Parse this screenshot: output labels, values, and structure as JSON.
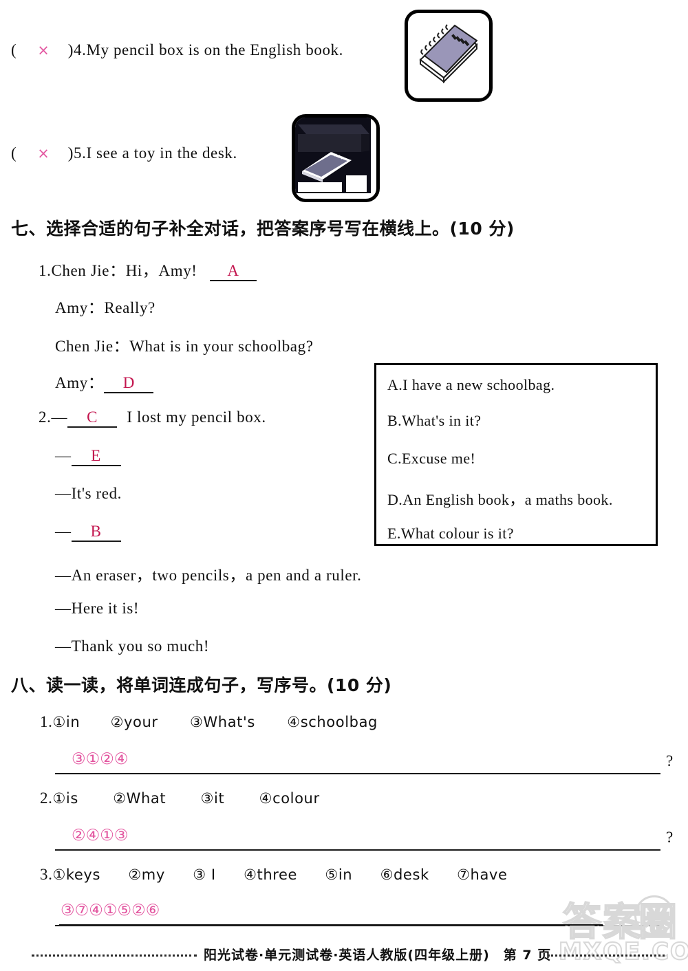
{
  "truefalse": {
    "items": [
      {
        "open": "(",
        "mark": "×",
        "close": ")",
        "number": "4.",
        "sentence": "My pencil box is on the English book.",
        "picture": "notebook-icon"
      },
      {
        "open": "(",
        "mark": "×",
        "close": ")",
        "number": "5.",
        "sentence": "I see a toy in the desk.",
        "picture": "desk-with-notebook-icon"
      }
    ]
  },
  "section7": {
    "heading": "七、选择合适的句子补全对话，把答案序号写在横线上。(10 分)",
    "dialog1": {
      "number": "1.",
      "lines": [
        {
          "speaker": "Chen Jie：",
          "text": "Hi，Amy!",
          "answer": "A"
        },
        {
          "speaker": "Amy：",
          "text": "Really?",
          "answer": ""
        },
        {
          "speaker": "Chen Jie：",
          "text": "What is in your schoolbag?",
          "answer": ""
        },
        {
          "speaker": "Amy：",
          "text": "",
          "answer": "D"
        }
      ]
    },
    "dialog2": {
      "number": "2.",
      "lines": [
        {
          "dash": "—",
          "answer": "C",
          "text": "I lost my pencil box."
        },
        {
          "dash": "—",
          "answer": "E",
          "text": ""
        },
        {
          "dash": "—",
          "answer": "",
          "text": "It's red."
        },
        {
          "dash": "—",
          "answer": "B",
          "text": ""
        },
        {
          "dash": "—",
          "answer": "",
          "text": "An eraser，two pencils，a pen and a ruler."
        },
        {
          "dash": "—",
          "answer": "",
          "text": "Here it is!"
        },
        {
          "dash": "—",
          "answer": "",
          "text": "Thank you so much!"
        }
      ]
    },
    "options": [
      "A.I have a new schoolbag.",
      "B.What's in it?",
      "C.Excuse me!",
      "D.An English book，a maths book.",
      "E.What colour is it?"
    ]
  },
  "section8": {
    "heading": "八、读一读，将单词连成句子，写序号。(10 分)",
    "items": [
      {
        "number": "1.",
        "words": [
          "①in",
          "②your",
          "③What's",
          "④schoolbag"
        ],
        "answer": "③①②④",
        "end_punct": "?"
      },
      {
        "number": "2.",
        "words": [
          "①is",
          "②What",
          "③it",
          "④colour"
        ],
        "answer": "②④①③",
        "end_punct": "?"
      },
      {
        "number": "3.",
        "words": [
          "①keys",
          "②my",
          "③ I",
          "④three",
          "⑤in",
          "⑥desk",
          "⑦have"
        ],
        "answer": "③⑦④①⑤②⑥",
        "end_punct": ""
      }
    ]
  },
  "footer": {
    "text": "阳光试卷·单元测试卷·英语人教版(四年级上册)　第 7 页"
  },
  "watermark": {
    "chinese": "答案",
    "circle_char": "圈",
    "site": "MXQE.COM"
  },
  "colors": {
    "answer_letter": "#C3154E",
    "answer_pink": "#E356A0",
    "ink": "#111111"
  }
}
